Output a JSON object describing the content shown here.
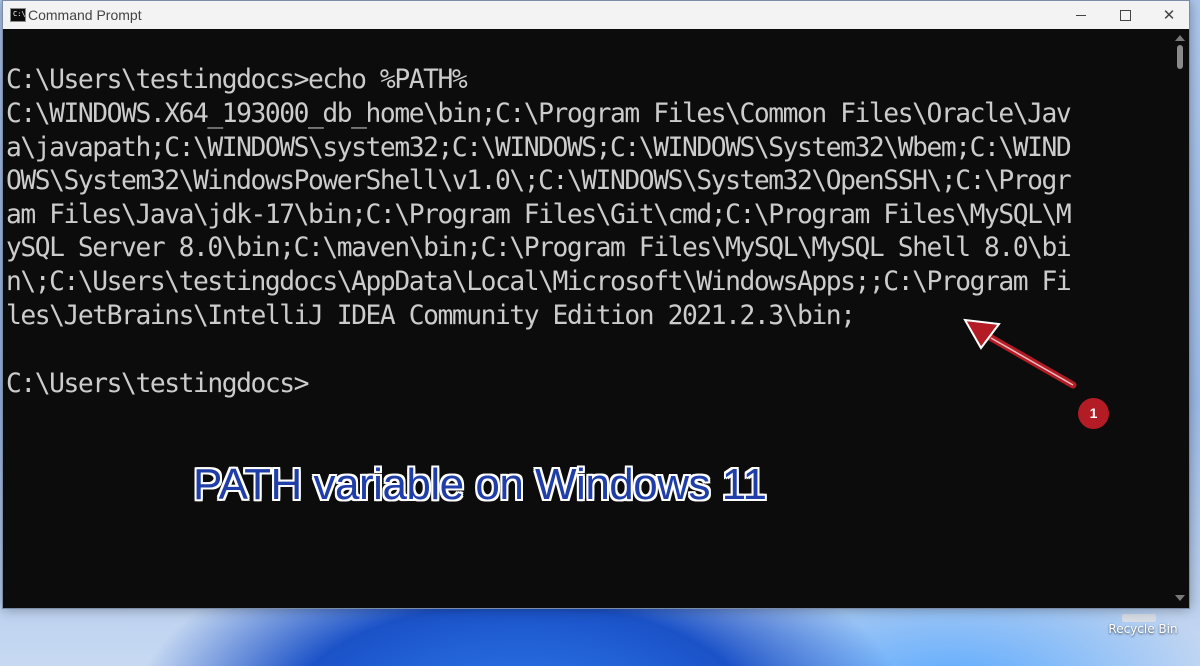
{
  "window": {
    "title": "Command Prompt",
    "icon": "cmd-icon",
    "icon_text": "C:\\."
  },
  "console": {
    "lines": [
      "C:\\Users\\testingdocs>echo %PATH%",
      "C:\\WINDOWS.X64_193000_db_home\\bin;C:\\Program Files\\Common Files\\Oracle\\Jav",
      "a\\javapath;C:\\WINDOWS\\system32;C:\\WINDOWS;C:\\WINDOWS\\System32\\Wbem;C:\\WIND",
      "OWS\\System32\\WindowsPowerShell\\v1.0\\;C:\\WINDOWS\\System32\\OpenSSH\\;C:\\Progr",
      "am Files\\Java\\jdk-17\\bin;C:\\Program Files\\Git\\cmd;C:\\Program Files\\MySQL\\M",
      "ySQL Server 8.0\\bin;C:\\maven\\bin;C:\\Program Files\\MySQL\\MySQL Shell 8.0\\bi",
      "n\\;C:\\Users\\testingdocs\\AppData\\Local\\Microsoft\\WindowsApps;;C:\\Program Fi",
      "les\\JetBrains\\IntelliJ IDEA Community Edition 2021.2.3\\bin;",
      "",
      "C:\\Users\\testingdocs>"
    ]
  },
  "annotation": {
    "caption": "PATH variable on Windows 11",
    "badge": "1",
    "caption_color": "#1f3ea8",
    "arrow_color": "#b31c24"
  },
  "desktop": {
    "recycle_bin_label": "Recycle Bin"
  }
}
